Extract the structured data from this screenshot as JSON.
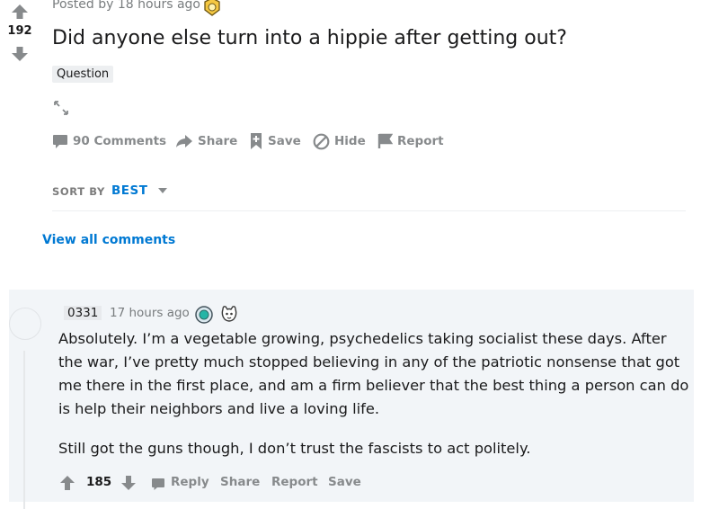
{
  "post": {
    "posted_text": "Posted by 18 hours ago",
    "score": "192",
    "title": "Did anyone else turn into a hippie after getting out?",
    "flair": "Question",
    "actions": {
      "comments": "90 Comments",
      "share": "Share",
      "save": "Save",
      "hide": "Hide",
      "report": "Report"
    }
  },
  "sort": {
    "label": "SORT BY",
    "value": "BEST"
  },
  "view_all_comments": "View all comments",
  "comment": {
    "author": "0331",
    "time": "17 hours ago",
    "paragraphs": [
      "Absolutely. I’m a vegetable growing, psychedelics taking socialist these days. After the war, I’ve pretty much stopped believing in any of the patriotic nonsense that got me there in the first place, and am a firm believer that the best thing a person can do is help their neighbors and live a loving life.",
      "Still got the guns though, I don’t trust the fascists to act politely."
    ],
    "score": "185",
    "actions": {
      "reply": "Reply",
      "share": "Share",
      "report": "Report",
      "save": "Save"
    }
  },
  "colors": {
    "accent": "#0079d3",
    "muted": "#878a8c",
    "comment_bg": "#f2f5f8"
  }
}
